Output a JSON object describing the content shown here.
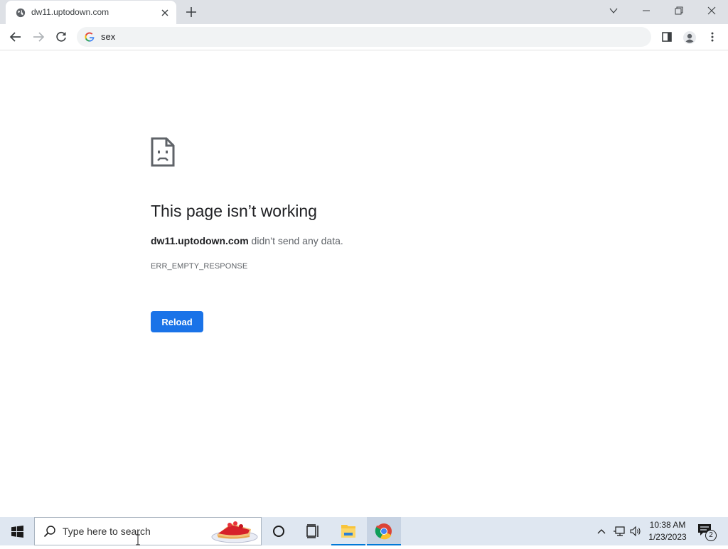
{
  "browser": {
    "tab": {
      "title": "dw11.uptodown.com",
      "icon": "globe-icon"
    },
    "new_tab_icon": "plus-icon",
    "window_controls": [
      "tab-search",
      "minimize",
      "restore",
      "close"
    ],
    "address_bar": {
      "value": "sex",
      "search_engine_icon": "google-g-icon"
    },
    "nav": [
      "back",
      "forward",
      "reload"
    ]
  },
  "error_page": {
    "icon": "sad-page-icon",
    "title": "This page isn’t working",
    "host": "dw11.uptodown.com",
    "message_rest": " didn’t send any data.",
    "code": "ERR_EMPTY_RESPONSE",
    "reload_label": "Reload"
  },
  "taskbar": {
    "search_placeholder": "Type here to search",
    "pinned": [
      "cortana",
      "task-view",
      "file-explorer",
      "chrome"
    ],
    "active_app": "chrome",
    "clock": {
      "time": "10:38 AM",
      "date": "1/23/2023"
    },
    "notification_count": "2"
  },
  "colors": {
    "tabstrip": "#dee1e6",
    "accent_blue": "#1a73e8",
    "taskbar": "#dfe7f1"
  }
}
